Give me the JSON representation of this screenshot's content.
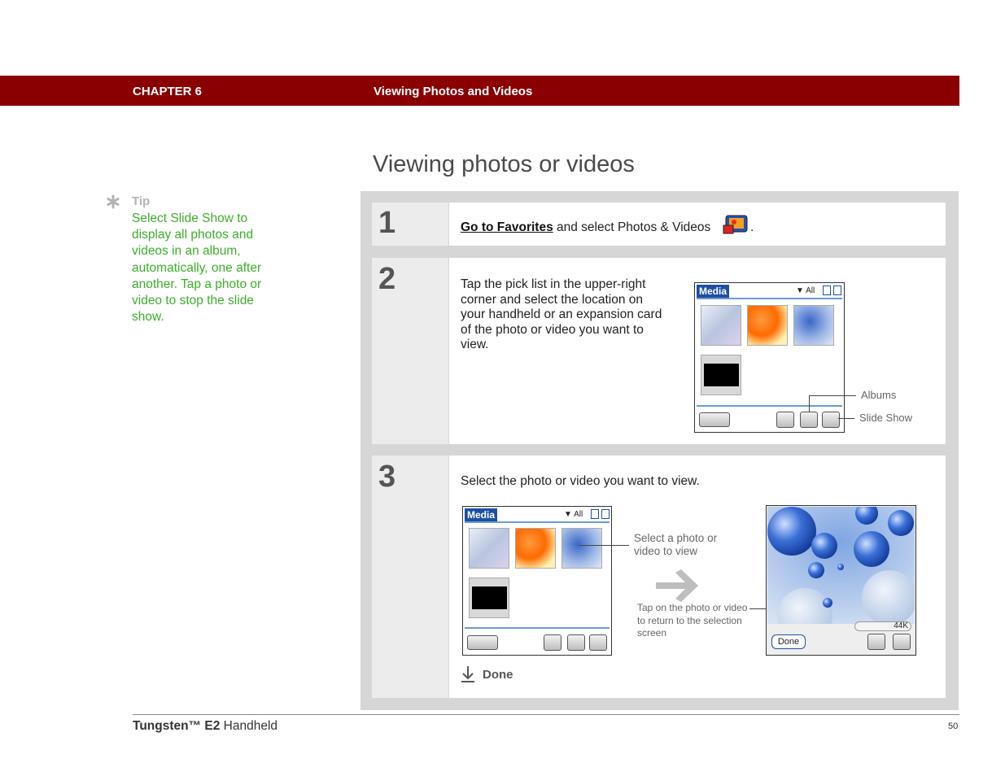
{
  "header": {
    "chapter": "CHAPTER 6",
    "title": "Viewing Photos and Videos"
  },
  "page_title": "Viewing photos or videos",
  "tip": {
    "label": "Tip",
    "text": "Select Slide Show to display all photos and videos in an album, automatically, one after another. Tap a photo or video to stop the slide show."
  },
  "steps": [
    {
      "number": "1",
      "link": "Go to Favorites",
      "text": " and select Photos & Videos",
      "end": "."
    },
    {
      "number": "2",
      "text": "Tap the pick list in the upper-right corner and select the location on your handheld or an expansion card of the photo or video you want to view.",
      "callouts": {
        "albums": "Albums",
        "slideshow": "Slide Show"
      }
    },
    {
      "number": "3",
      "text": "Select the photo or video you want to view.",
      "callouts": {
        "select": "Select a photo or video to view",
        "tap": "Tap on the photo or video to return to the selection screen"
      },
      "done": "Done"
    }
  ],
  "palm": {
    "title": "Media",
    "picklist": "All",
    "size": "44K",
    "done_button": "Done"
  },
  "footer": {
    "product": "Tungsten™ E2",
    "suffix": " Handheld",
    "page": "50"
  },
  "colors": {
    "header": "#8a0000",
    "tip": "#3cae2b",
    "palm_title": "#1d4fa3"
  }
}
